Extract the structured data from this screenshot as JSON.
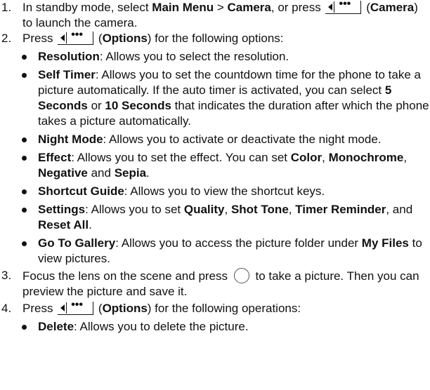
{
  "softkey_glyph": "•••",
  "step1": {
    "num": "1.",
    "t1": "In standby mode, select ",
    "b1": "Main Menu",
    "t2": " > ",
    "b2": "Camera",
    "t3": ", or press ",
    "t4": " (",
    "b3": "Camera",
    "t5": ") to launch the camera."
  },
  "step2": {
    "num": "2.",
    "t1": "Press ",
    "t2": " (",
    "b1": "Options",
    "t3": ") for the following options:",
    "bullets": [
      {
        "b": "Resolution",
        "t": ": Allows you to select the resolution."
      },
      {
        "b": "Self Timer",
        "t": ": Allows you to set the countdown time for the phone to take a picture automatically. If the auto timer is activated, you can select ",
        "b2": "5 Seconds",
        "t2": " or ",
        "b3": "10 Seconds",
        "t3": " that indicates the duration after which the phone takes a picture automatically."
      },
      {
        "b": "Night Mode",
        "t": ": Allows you to activate or deactivate the night mode."
      },
      {
        "b": "Effect",
        "t": ": Allows you to set the effect. You can set ",
        "b2": "Color",
        "t2": ", ",
        "b3": "Monochrome",
        "t3": ", ",
        "b4": "Negative",
        "t4": " and ",
        "b5": "Sepia",
        "t5": "."
      },
      {
        "b": "Shortcut Guide",
        "t": ": Allows you to view the shortcut keys."
      },
      {
        "b": "Settings",
        "t": ": Allows you to set ",
        "b2": "Quality",
        "t2": ", ",
        "b3": "Shot Tone",
        "t3": ", ",
        "b4": "Timer Reminder",
        "t4": ", and ",
        "b5": "Reset All",
        "t5": "."
      },
      {
        "b": "Go To Gallery",
        "t": ": Allows you to access the picture folder under ",
        "b2": "My Files",
        "t2": " to view pictures."
      }
    ]
  },
  "step3": {
    "num": "3.",
    "t1": "Focus the lens on the scene and press ",
    "t2": " to take a picture. Then you can preview the picture and save it."
  },
  "step4": {
    "num": "4.",
    "t1": "Press ",
    "t2": " (",
    "b1": "Options",
    "t3": ") for the following operations:",
    "bullets": [
      {
        "b": "Delete",
        "t": ": Allows you to delete the picture."
      }
    ]
  }
}
